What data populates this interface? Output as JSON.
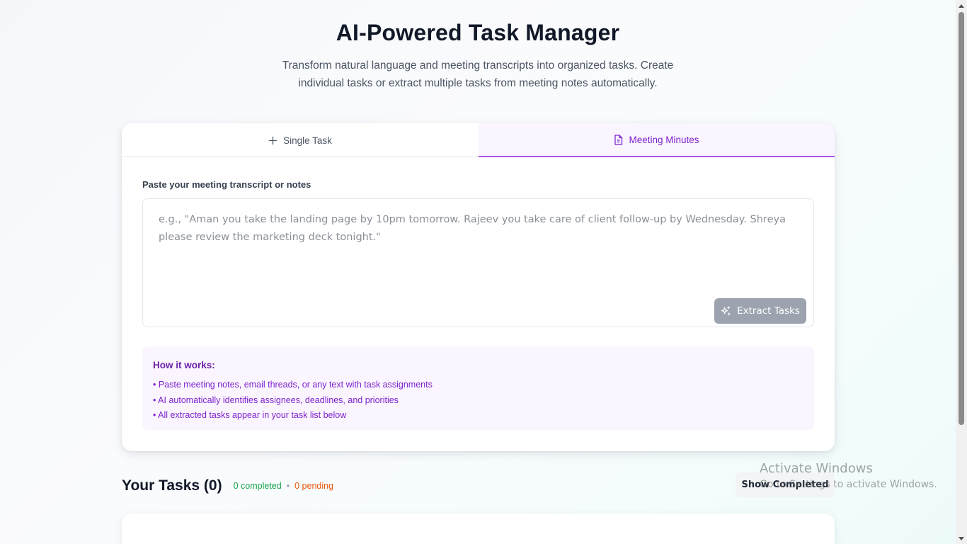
{
  "header": {
    "title": "AI-Powered Task Manager",
    "subtitle": "Transform natural language and meeting transcripts into organized tasks. Create individual tasks or extract multiple tasks from meeting notes automatically."
  },
  "tabs": [
    {
      "label": "Single Task",
      "icon": "plus-icon",
      "active": false
    },
    {
      "label": "Meeting Minutes",
      "icon": "document-icon",
      "active": true
    }
  ],
  "meeting": {
    "label": "Paste your meeting transcript or notes",
    "placeholder": "e.g., \"Aman you take the landing page by 10pm tomorrow. Rajeev you take care of client follow-up by Wednesday. Shreya please review the marketing deck tonight.\"",
    "value": "",
    "extract_label": "Extract Tasks",
    "extract_icon": "sparkles-icon"
  },
  "how_it_works": {
    "title": "How it works:",
    "items": [
      "• Paste meeting notes, email threads, or any text with task assignments",
      "• AI automatically identifies assignees, deadlines, and priorities",
      "• All extracted tasks appear in your task list below"
    ]
  },
  "tasks": {
    "title": "Your Tasks (0)",
    "completed": "0 completed",
    "separator": "•",
    "pending": "0 pending",
    "show_completed_label": "Show Completed"
  },
  "windows_watermark": {
    "line1": "Activate Windows",
    "line2": "Go to Settings to activate Windows."
  },
  "colors": {
    "accent": "#7e22ce",
    "tab_active_bg": "#faf5ff",
    "completed": "#16a34a",
    "pending": "#ea580c",
    "button_disabled": "#9ca3af"
  }
}
